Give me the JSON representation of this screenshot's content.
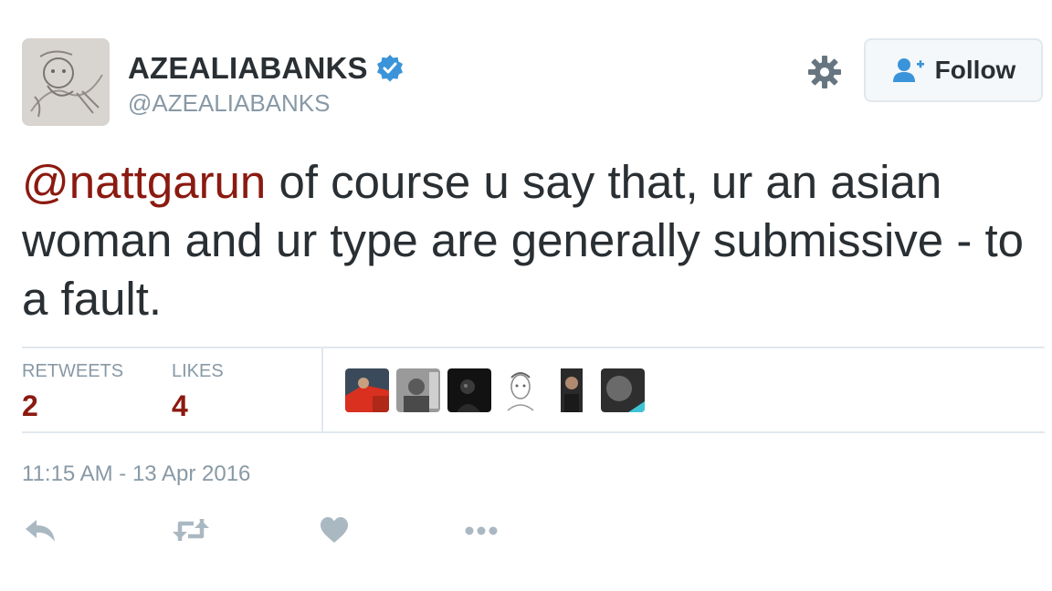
{
  "author": {
    "display_name": "AZEALIABANKS",
    "handle": "@AZEALIABANKS",
    "verified": true,
    "verified_color": "#3b94d9"
  },
  "follow_button": {
    "label": "Follow",
    "icon": "add-user-icon"
  },
  "settings_icon": "gear-icon",
  "tweet": {
    "mention": "@nattgarun",
    "text": " of course u say that, ur an asian woman and ur type are generally submissive - to a fault."
  },
  "stats": {
    "retweets": {
      "label": "RETWEETS",
      "value": "2"
    },
    "likes": {
      "label": "LIKES",
      "value": "4"
    }
  },
  "likers_count_shown": 6,
  "timestamp": "11:15 AM - 13 Apr 2016",
  "actions": [
    "reply-icon",
    "retweet-icon",
    "like-icon",
    "more-icon"
  ],
  "colors": {
    "text": "#292f33",
    "muted": "#8899a6",
    "mention": "#8b1a10",
    "border": "#e1e8ed",
    "action_icon": "#aab8c2"
  }
}
